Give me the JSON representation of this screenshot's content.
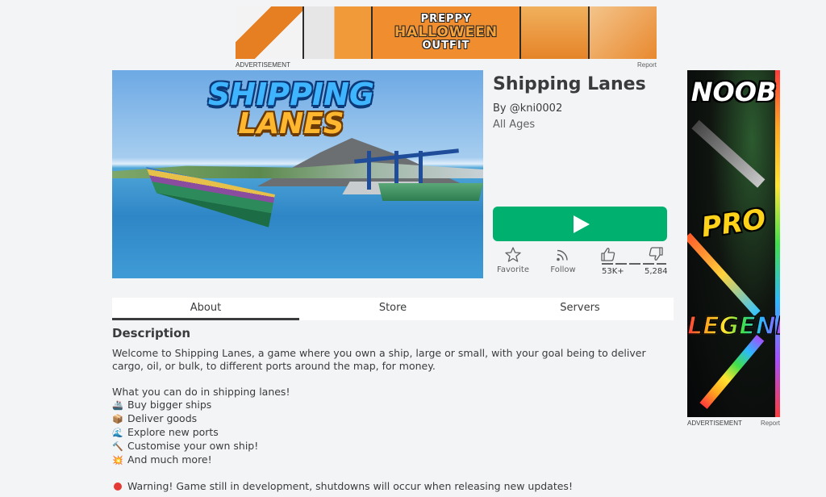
{
  "top_ad": {
    "banner_lines": [
      "PREPPY",
      "HALLOWEEN",
      "OUTFIT"
    ],
    "label": "ADVERTISEMENT",
    "report": "Report"
  },
  "thumbnail": {
    "logo_line1": "SHIPPING",
    "logo_line2": "LANES"
  },
  "game": {
    "title": "Shipping Lanes",
    "by_label": "By",
    "creator": "@kni0002",
    "age_rating": "All Ages",
    "play_icon": "play-icon"
  },
  "actions": {
    "favorite_label": "Favorite",
    "follow_label": "Follow",
    "upvotes": "53K+",
    "downvotes": "5,284"
  },
  "tabs": [
    {
      "label": "About",
      "active": true
    },
    {
      "label": "Store",
      "active": false
    },
    {
      "label": "Servers",
      "active": false
    }
  ],
  "description": {
    "heading": "Description",
    "intro": "Welcome to Shipping Lanes, a game where you own a ship, large or small, with your goal being to deliver cargo, oil, or bulk, to different ports around the map, for money.",
    "list_heading": "What you can do in shipping lanes!",
    "items": [
      {
        "icon": "🚢",
        "text": "Buy bigger ships"
      },
      {
        "icon": "📦",
        "text": "Deliver goods"
      },
      {
        "icon": "🌊",
        "text": "Explore new ports"
      },
      {
        "icon": "🔨",
        "text": "Customise your own ship!"
      },
      {
        "icon": "💥",
        "text": "And much more!"
      }
    ],
    "warning": "Warning! Game still in development, shutdowns will occur when releasing new updates!"
  },
  "side_ad": {
    "words": [
      "NOOB",
      "PRO",
      "LEGEND"
    ],
    "label": "ADVERTISEMENT",
    "report": "Report"
  },
  "colors": {
    "play_button": "#00b06f",
    "page_bg": "#f2f4f5",
    "text": "#393b3d",
    "warning_dot": "#e53935"
  }
}
